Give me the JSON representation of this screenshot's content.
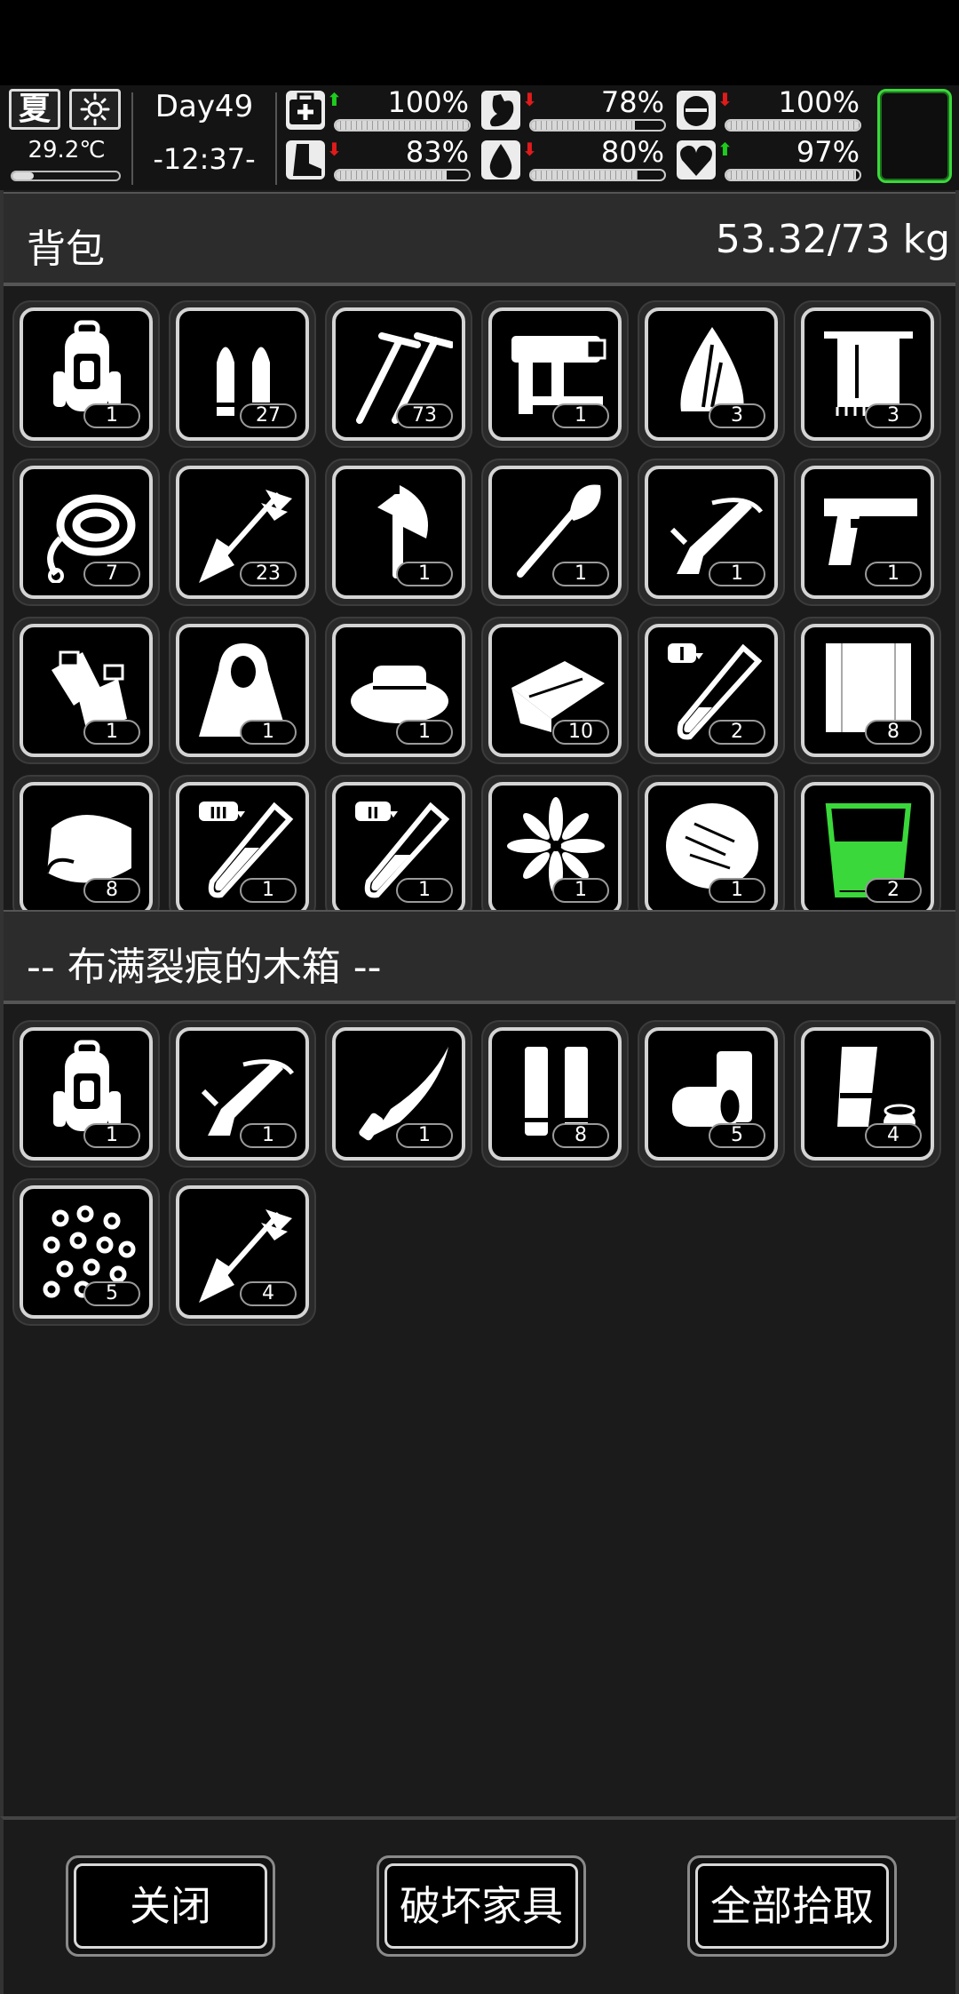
{
  "status": {
    "season": "夏",
    "weather_icon": "sun-icon",
    "temperature": "29.2℃",
    "temperature_level": 0.2,
    "day": "Day49",
    "time": "-12:37-",
    "stats": [
      {
        "icon": "health-kit-icon",
        "trend": "up",
        "value": "100%",
        "level": 1.0
      },
      {
        "icon": "stomach-icon",
        "trend": "down",
        "value": "78%",
        "level": 0.78
      },
      {
        "icon": "pill-icon",
        "trend": "down",
        "value": "100%",
        "level": 1.0
      },
      {
        "icon": "foot-icon",
        "trend": "down",
        "value": "83%",
        "level": 0.83
      },
      {
        "icon": "water-drop-icon",
        "trend": "down",
        "value": "80%",
        "level": 0.8
      },
      {
        "icon": "heart-icon",
        "trend": "up",
        "value": "97%",
        "level": 0.97
      }
    ],
    "trend_arrows": {
      "up": "⬆",
      "down": "⬇"
    },
    "colors": {
      "up": "#1ecb1e",
      "down": "#e01b1b",
      "profile_border": "#3ad83a"
    }
  },
  "backpack": {
    "title": "背包",
    "weight": "53.32/73 kg",
    "items": [
      {
        "icon": "backpack-icon",
        "count": "1"
      },
      {
        "icon": "bullets-icon",
        "count": "27"
      },
      {
        "icon": "nails-icon",
        "count": "73"
      },
      {
        "icon": "nail-gun-icon",
        "count": "1"
      },
      {
        "icon": "leaf-icon",
        "count": "3"
      },
      {
        "icon": "towel-icon",
        "count": "3"
      },
      {
        "icon": "rope-icon",
        "count": "7"
      },
      {
        "icon": "arrow-icon",
        "count": "23"
      },
      {
        "icon": "axe-icon",
        "count": "1"
      },
      {
        "icon": "shovel-icon",
        "count": "1"
      },
      {
        "icon": "crossbow-icon",
        "count": "1"
      },
      {
        "icon": "pistol-icon",
        "count": "1"
      },
      {
        "icon": "gloves-icon",
        "count": "1"
      },
      {
        "icon": "cloak-icon",
        "count": "1"
      },
      {
        "icon": "hat-icon",
        "count": "1"
      },
      {
        "icon": "cloth-icon",
        "count": "10"
      },
      {
        "icon": "test-tube-1-icon",
        "count": "2"
      },
      {
        "icon": "fabric-icon",
        "count": "8"
      },
      {
        "icon": "blanket-icon",
        "count": "8"
      },
      {
        "icon": "test-tube-3-icon",
        "count": "1"
      },
      {
        "icon": "test-tube-2-icon",
        "count": "1"
      },
      {
        "icon": "flower-icon",
        "count": "1"
      },
      {
        "icon": "fiber-icon",
        "count": "1"
      },
      {
        "icon": "green-drink-icon",
        "count": "2"
      }
    ]
  },
  "container": {
    "title": "-- 布满裂痕的木箱 --",
    "items": [
      {
        "icon": "backpack-icon",
        "count": "1"
      },
      {
        "icon": "crossbow-icon",
        "count": "1"
      },
      {
        "icon": "machete-icon",
        "count": "1"
      },
      {
        "icon": "shells-icon",
        "count": "8"
      },
      {
        "icon": "cans-icon",
        "count": "5"
      },
      {
        "icon": "cup-icon",
        "count": "4"
      },
      {
        "icon": "pellets-icon",
        "count": "5"
      },
      {
        "icon": "arrow-icon",
        "count": "4"
      }
    ]
  },
  "buttons": {
    "close": "关闭",
    "destroy": "破坏家具",
    "pick_all": "全部拾取"
  }
}
